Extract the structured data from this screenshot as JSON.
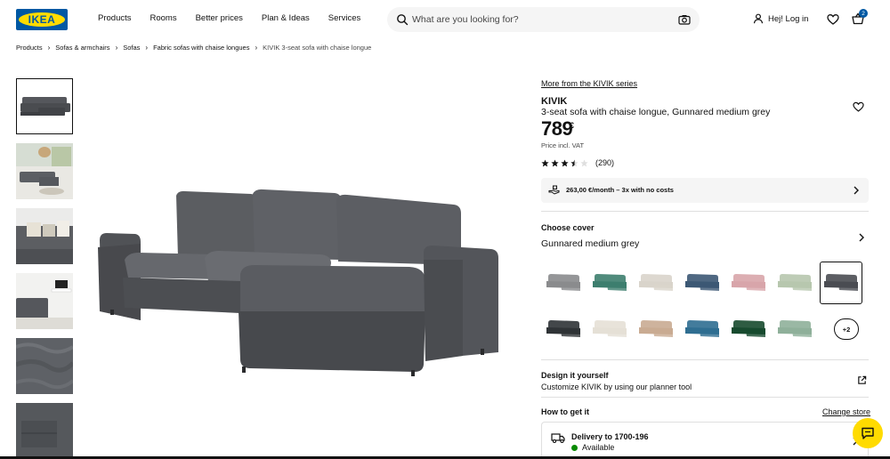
{
  "header": {
    "logo_text": "IKEA",
    "nav": [
      "Products",
      "Rooms",
      "Better prices",
      "Plan & Ideas",
      "Services"
    ],
    "search_placeholder": "What are you looking for?",
    "login_label": "Hej! Log in",
    "cart_count": "2"
  },
  "breadcrumb": [
    "Products",
    "Sofas & armchairs",
    "Sofas",
    "Fabric sofas with chaise longues",
    "KIVIK 3-seat sofa with chaise longue"
  ],
  "product": {
    "more_series_link": "More from the KIVIK series",
    "name": "KIVIK",
    "description": "3-seat sofa with chaise longue, Gunnared medium grey",
    "price": "789",
    "currency": "€",
    "vat_note": "Price incl. VAT",
    "rating_value": 3.5,
    "rating_max": 5,
    "review_count": "(290)",
    "payment_offer": "263,00 €/month – 3x with no costs"
  },
  "cover": {
    "title": "Choose cover",
    "selected_name": "Gunnared medium grey",
    "more_label": "+2",
    "swatch_colors": [
      "#8a8b8d",
      "#3d7e6e",
      "#d9d4cb",
      "#3c5874",
      "#d8a5aa",
      "#b7c7ae",
      "#4a4c52",
      "#2f3336",
      "#e5e0d6",
      "#c9ab92",
      "#2f6e91",
      "#174a2e",
      "#8fb09a"
    ],
    "selected_index": 6
  },
  "design": {
    "title": "Design it yourself",
    "subtitle": "Customize KIVIK by using our planner tool"
  },
  "fulfillment": {
    "title": "How to get it",
    "change_store": "Change store",
    "delivery_title": "Delivery to 1700-196",
    "availability": "Available"
  },
  "colors": {
    "brand_blue": "#0058a3",
    "brand_yellow": "#ffdb00",
    "available_green": "#0a8a00"
  },
  "icons": [
    "search-icon",
    "camera-icon",
    "person-icon",
    "heart-icon",
    "bag-icon",
    "chevron-right-icon",
    "star-icon",
    "payment-hand-icon",
    "external-link-icon",
    "truck-icon",
    "chat-icon"
  ]
}
